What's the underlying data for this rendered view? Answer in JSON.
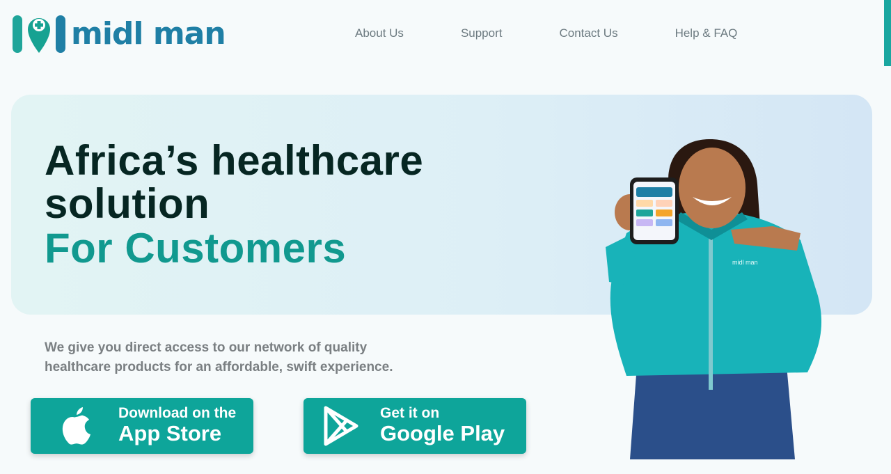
{
  "header": {
    "logo_text": "midl man",
    "nav": [
      "About Us",
      "Support",
      "Contact Us",
      "Help & FAQ"
    ]
  },
  "hero": {
    "title_line1": "Africa’s healthcare",
    "title_line2": "solution",
    "subtitle": "For Customers",
    "description": "We give you direct access to our network of quality healthcare products for an affordable, swift experience."
  },
  "buttons": {
    "app_store": {
      "small": "Download on the",
      "big": "App Store"
    },
    "google_play": {
      "small": "Get it on",
      "big": "Google Play"
    }
  },
  "colors": {
    "brand": "#1f7fa5",
    "accent": "#0ea59a",
    "title": "#062622",
    "subtitle": "#11998f"
  },
  "icons": [
    "logo-mark-icon",
    "apple-icon",
    "google-play-icon"
  ]
}
